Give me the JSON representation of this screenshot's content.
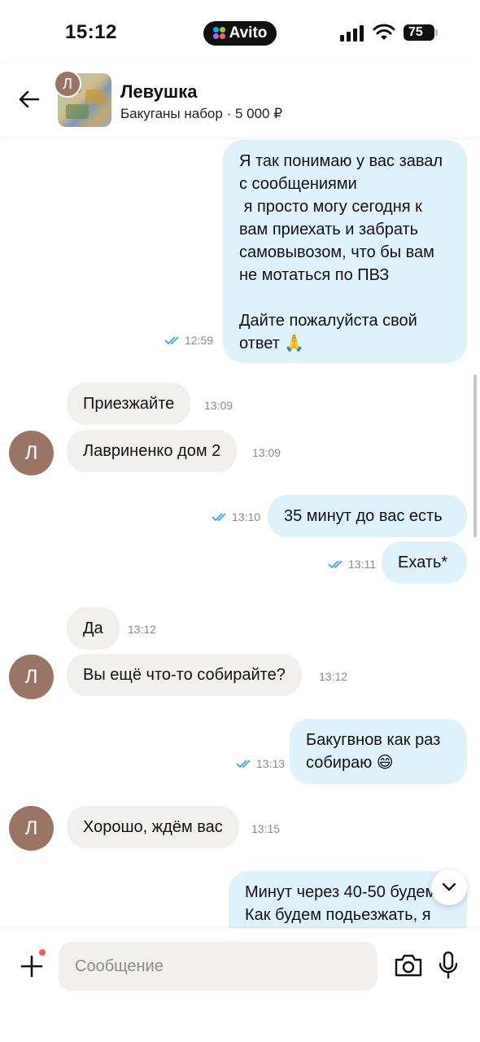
{
  "status_bar": {
    "time": "15:12",
    "app_pill": "Avito",
    "battery": "75"
  },
  "header": {
    "avatar_letter": "Л",
    "name": "Левушка",
    "listing": "Бакуганы набор · 5 000 ₽"
  },
  "messages": [
    {
      "dir": "out",
      "text": "Я так понимаю у вас завал\nс сообщениями\n я просто могу сегодня к\nвам приехать и забрать\nсамовывозом, что бы вам\nне мотаться по ПВЗ\n\nДайте пожалуйста свой\nответ 🙏",
      "time": "12:59"
    },
    {
      "dir": "in",
      "text": "Приезжайте",
      "time": "13:09"
    },
    {
      "dir": "in",
      "text": "Лавриненко дом 2",
      "time": "13:09",
      "avatar": "Л"
    },
    {
      "dir": "out",
      "text": "35 минут до вас есть",
      "time": "13:10"
    },
    {
      "dir": "out",
      "text": "Ехать*",
      "time": "13:11"
    },
    {
      "dir": "in",
      "text": "Да",
      "time": "13:12"
    },
    {
      "dir": "in",
      "text": "Вы ещё что-то собирайте?",
      "time": "13:12",
      "avatar": "Л"
    },
    {
      "dir": "out",
      "text": "Бакугвнов как раз\nсобираю 😄",
      "time": "13:13"
    },
    {
      "dir": "in",
      "text": "Хорошо, ждём вас",
      "time": "13:15",
      "avatar": "Л"
    },
    {
      "dir": "out",
      "text": "Минут через 40-50 будем\nКак будем подьезжать, я"
    }
  ],
  "input": {
    "placeholder": "Сообщение"
  },
  "colors": {
    "incoming_bubble": "#f1f0ef",
    "outgoing_bubble": "#dff1fb",
    "read_ticks": "#3ba6e6",
    "avatar": "#9a7566",
    "notification_dot": "#ff5a5f"
  },
  "icons": [
    "back-arrow-icon",
    "double-check-icon",
    "chevron-down-icon",
    "plus-icon",
    "camera-icon",
    "microphone-icon",
    "wifi-icon",
    "signal-icon",
    "battery-icon"
  ]
}
